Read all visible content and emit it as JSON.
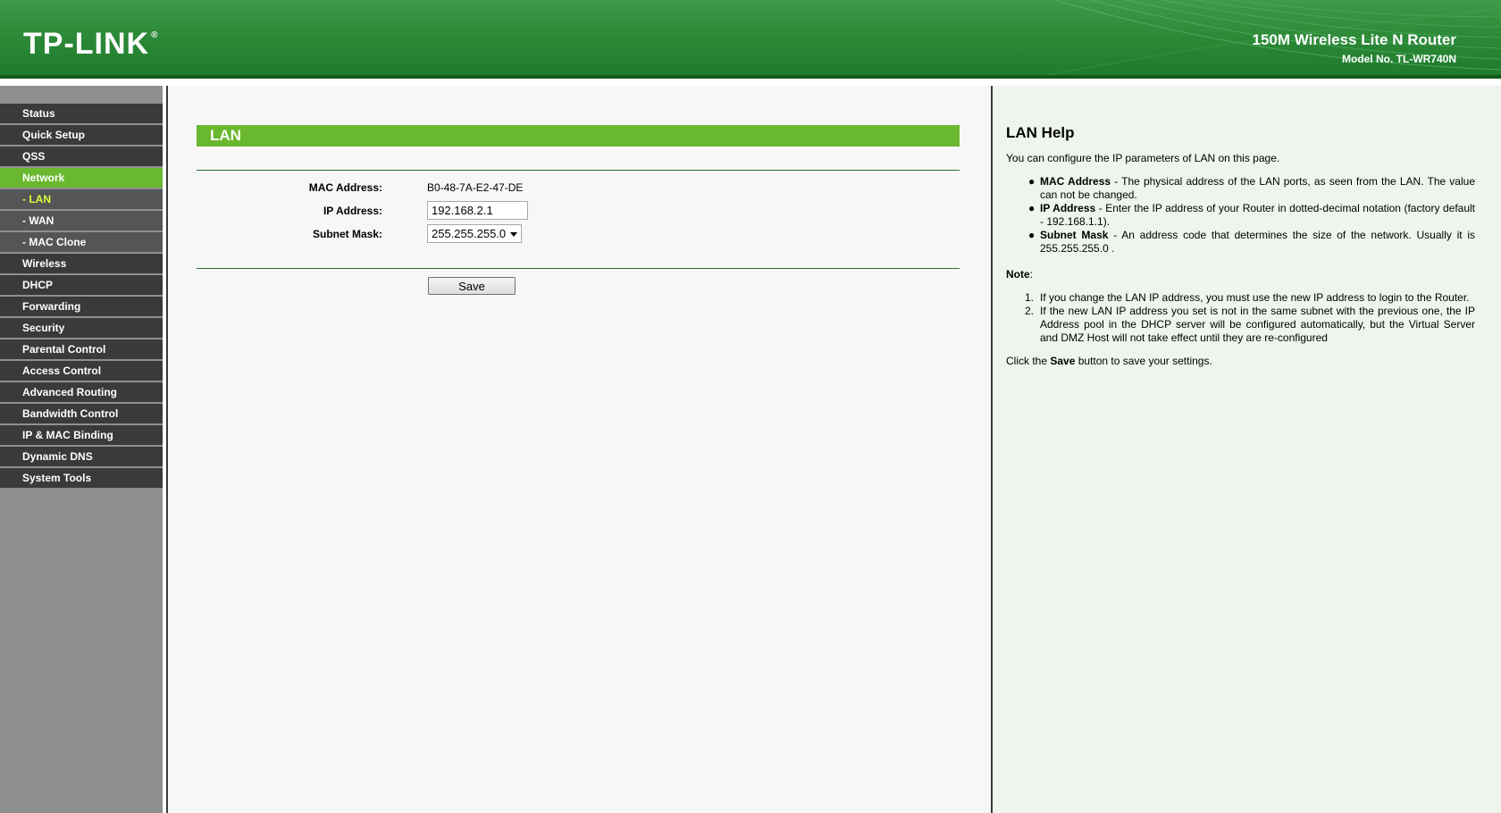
{
  "header": {
    "logo": "TP-LINK",
    "logo_mark": "®",
    "product_name": "150M Wireless Lite N Router",
    "model_no": "Model No. TL-WR740N"
  },
  "sidebar": {
    "items": [
      {
        "label": "Status"
      },
      {
        "label": "Quick Setup"
      },
      {
        "label": "QSS"
      },
      {
        "label": "Network"
      },
      {
        "label": "- LAN"
      },
      {
        "label": "- WAN"
      },
      {
        "label": "- MAC Clone"
      },
      {
        "label": "Wireless"
      },
      {
        "label": "DHCP"
      },
      {
        "label": "Forwarding"
      },
      {
        "label": "Security"
      },
      {
        "label": "Parental Control"
      },
      {
        "label": "Access Control"
      },
      {
        "label": "Advanced Routing"
      },
      {
        "label": "Bandwidth Control"
      },
      {
        "label": "IP & MAC Binding"
      },
      {
        "label": "Dynamic DNS"
      },
      {
        "label": "System Tools"
      }
    ],
    "active_item": "Network",
    "current_subitem": "- LAN"
  },
  "main": {
    "section_title": "LAN",
    "mac_label": "MAC Address:",
    "mac_value": "B0-48-7A-E2-47-DE",
    "ip_label": "IP Address:",
    "ip_value": "192.168.2.1",
    "mask_label": "Subnet Mask:",
    "mask_value": "255.255.255.0",
    "save_label": "Save"
  },
  "help": {
    "title": "LAN Help",
    "intro": "You can configure the IP parameters of LAN on this page.",
    "bullets": [
      {
        "term": "MAC Address",
        "text": " - The physical address of the LAN ports, as seen from the LAN. The value can not be changed."
      },
      {
        "term": "IP Address",
        "text": " - Enter the IP address of your Router in dotted-decimal notation (factory default - 192.168.1.1)."
      },
      {
        "term": "Subnet Mask",
        "text": " - An address code that determines the size of the network. Usually it is 255.255.255.0 ."
      }
    ],
    "note_title": "Note",
    "note_colon": ":",
    "notes": [
      {
        "num": "1.",
        "text": "If you change the LAN IP address, you must use the new IP address to login to the Router."
      },
      {
        "num": "2.",
        "text": "If the new LAN IP address you set is not in the same subnet with the previous one, the IP Address pool in the DHCP server will be configured automatically, but the Virtual Server and DMZ Host will not take effect until they are re-configured"
      }
    ],
    "save_note_prefix": "Click the ",
    "save_note_term": "Save",
    "save_note_suffix": " button to save your settings."
  },
  "colors": {
    "header_green": "#2c8a38",
    "menu_dark": "#3a3a3a",
    "menu_active": "#6ab82f",
    "submenu_current_text": "#d4ff3a",
    "section_title_bg": "#6ab82f",
    "help_bg": "#eef5ec"
  }
}
